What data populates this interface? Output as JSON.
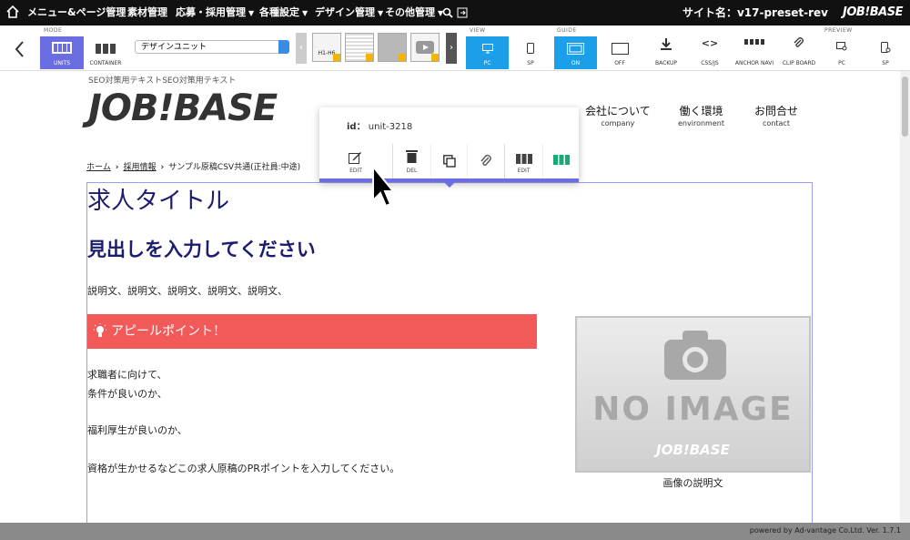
{
  "topbar": {
    "menus": [
      "メニュー&ページ管理",
      "素材管理",
      "応募・採用管理",
      "各種設定",
      "デザイン管理",
      "その他管理"
    ],
    "site_label": "サイト名：v17-preset-rev",
    "brand": "JOB!BASE"
  },
  "toolbar": {
    "mode_label": "MODE",
    "units_label": "UNITS",
    "container_label": "CONTAINER",
    "unit_select_value": "デザインユニット",
    "thumb_h1_label": "H1-H6",
    "view_label": "VIEW",
    "view_pc": "PC",
    "view_sp": "SP",
    "guide_label": "GUIDE",
    "guide_on": "ON",
    "guide_off": "OFF",
    "backup": "BACKUP",
    "cssjs": "CSS/JS",
    "anchor": "ANCHOR NAVI",
    "clipboard": "CLIP BOARD",
    "preview_label": "PREVIEW",
    "preview_pc": "PC",
    "preview_sp": "SP"
  },
  "page": {
    "seo_text": "SEO対策用テキストSEO対策用テキスト",
    "logo": "JOB!BASE",
    "nav": [
      {
        "label": "会社について",
        "sub": "company"
      },
      {
        "label": "働く環境",
        "sub": "environment"
      },
      {
        "label": "お問合せ",
        "sub": "contact"
      }
    ],
    "breadcrumb": [
      "ホーム",
      "採用情報",
      "サンプル原稿CSV共通(正社員:中途)"
    ],
    "job_title": "求人タイトル",
    "heading": "見出しを入力してください",
    "description": "説明文、説明文、説明文、説明文、説明文、",
    "appeal": "アピールポイント！",
    "body_lines": [
      "求職者に向けて、",
      "条件が良いのか、",
      "福利厚生が良いのか、",
      "資格が生かせるなどこの求人原稿のPRポイントを入力してください。"
    ],
    "noimage_text": "NO IMAGE",
    "noimage_brand": "JOB!BASE",
    "image_caption": "画像の説明文"
  },
  "popup": {
    "id_label": "id：",
    "id_value": "unit-3218",
    "edit": "EDIT",
    "del": "DEL",
    "edit2": "EDIT"
  },
  "footer": "powered by Ad-vantage Co.Ltd. Ver. 1.7.1",
  "colors": {
    "accent": "#6b6ee0",
    "blue": "#1a9fe8",
    "appeal": "#f25a5a",
    "heading": "#1c1c6e"
  }
}
